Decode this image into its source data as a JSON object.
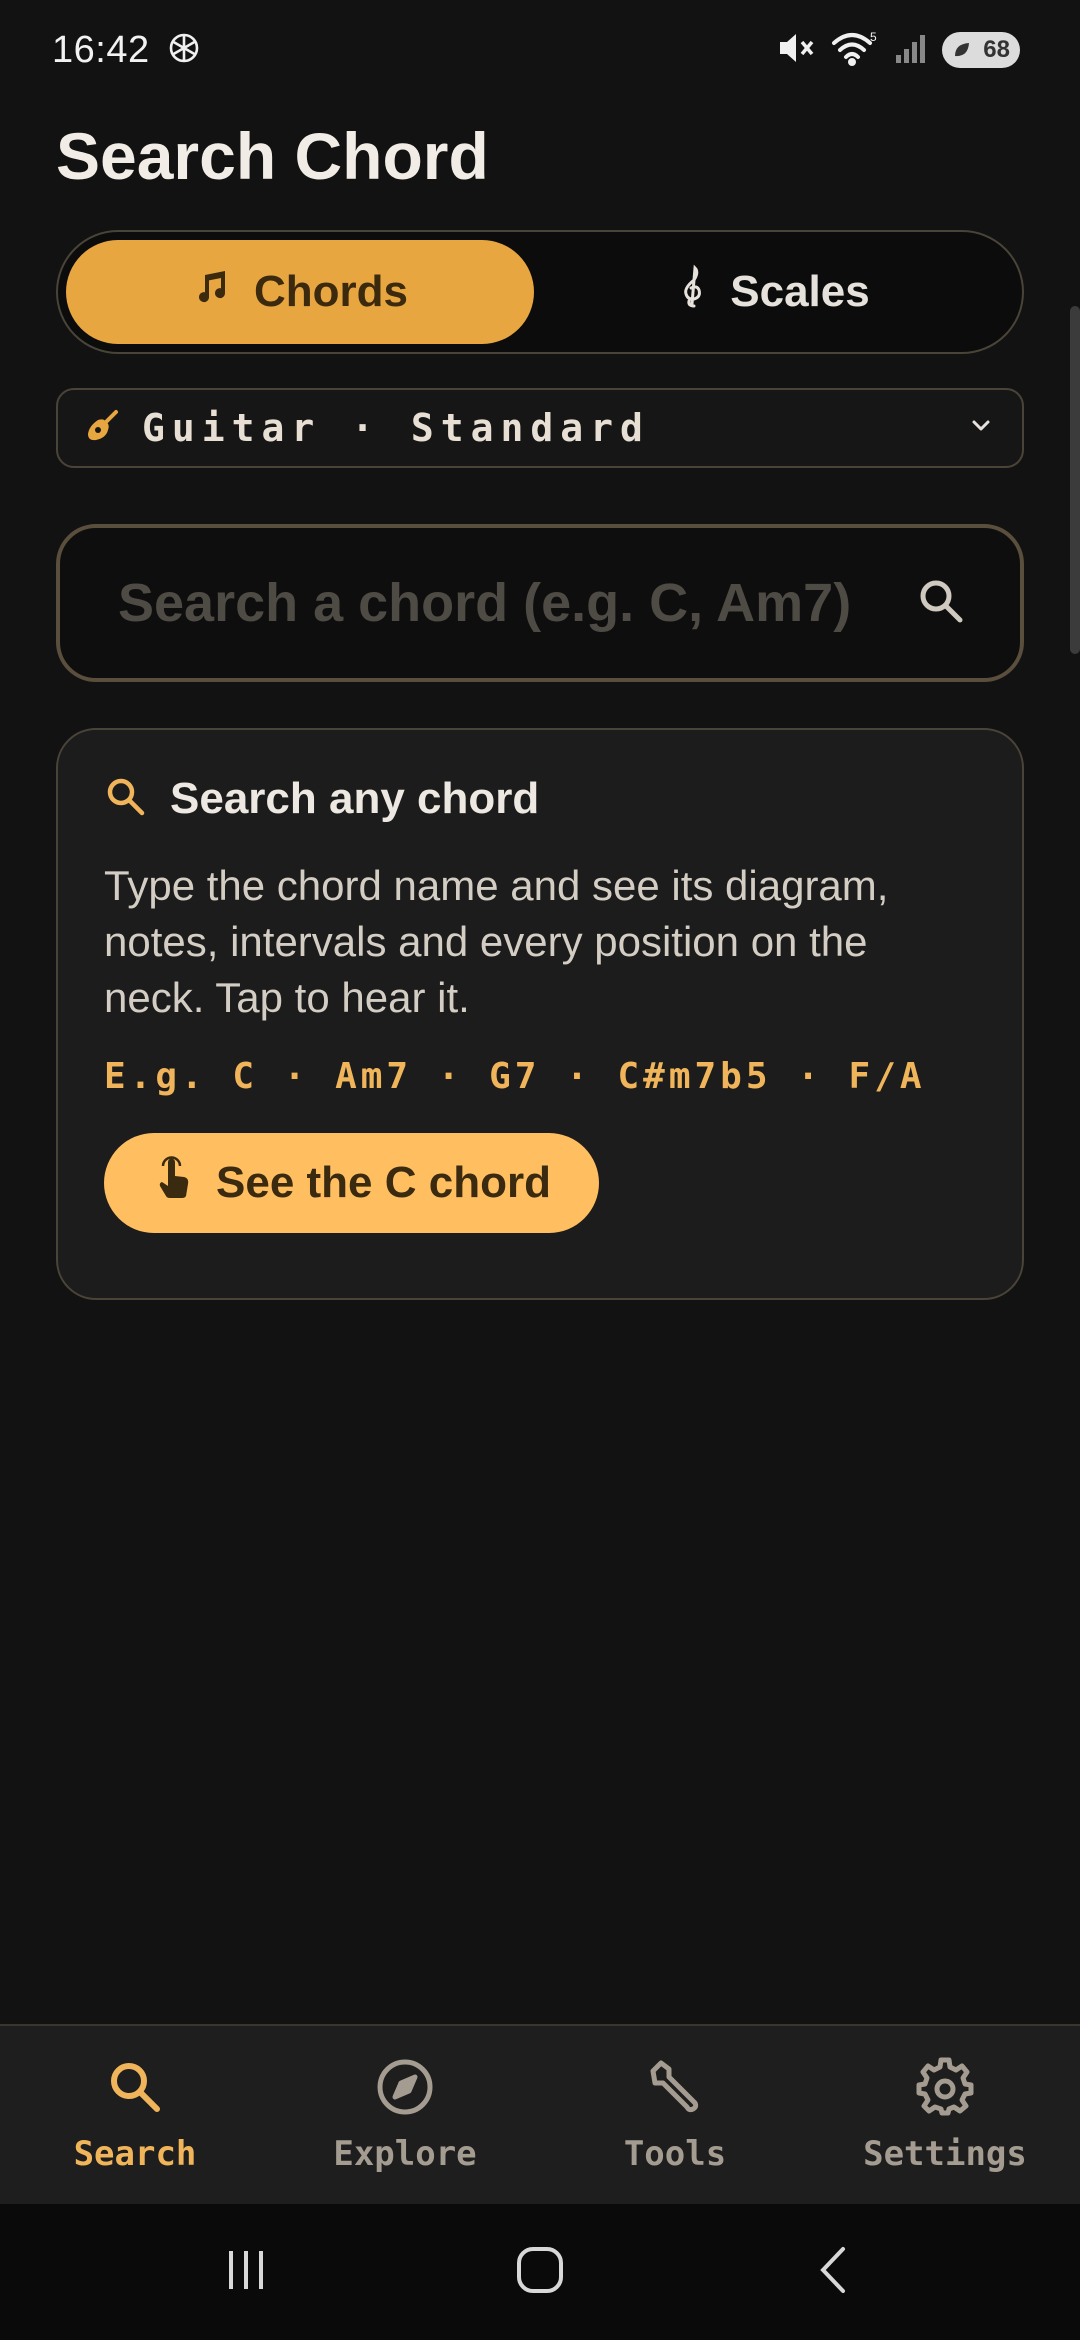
{
  "status_bar": {
    "time": "16:42",
    "battery": "68"
  },
  "page": {
    "title": "Search Chord"
  },
  "mode_tabs": {
    "chords": "Chords",
    "scales": "Scales"
  },
  "instrument": {
    "label": "Guitar · Standard"
  },
  "search": {
    "placeholder": "Search a chord (e.g. C, Am7)"
  },
  "card": {
    "title": "Search any chord",
    "text": "Type the chord name and see its diagram, notes, intervals and every position on the neck. Tap to hear it.",
    "examples": "E.g. C · Am7 · G7 · C#m7b5 · F/A",
    "cta": "See the C chord"
  },
  "bottom_nav": {
    "items": [
      {
        "label": "Search",
        "icon": "search-icon",
        "active": true
      },
      {
        "label": "Explore",
        "icon": "compass-icon",
        "active": false
      },
      {
        "label": "Tools",
        "icon": "wrench-icon",
        "active": false
      },
      {
        "label": "Settings",
        "icon": "gear-icon",
        "active": false
      }
    ]
  },
  "colors": {
    "accent": "#e8a640",
    "cta": "#ffbe60",
    "accent_text": "#f0b45a",
    "background": "#121212"
  }
}
